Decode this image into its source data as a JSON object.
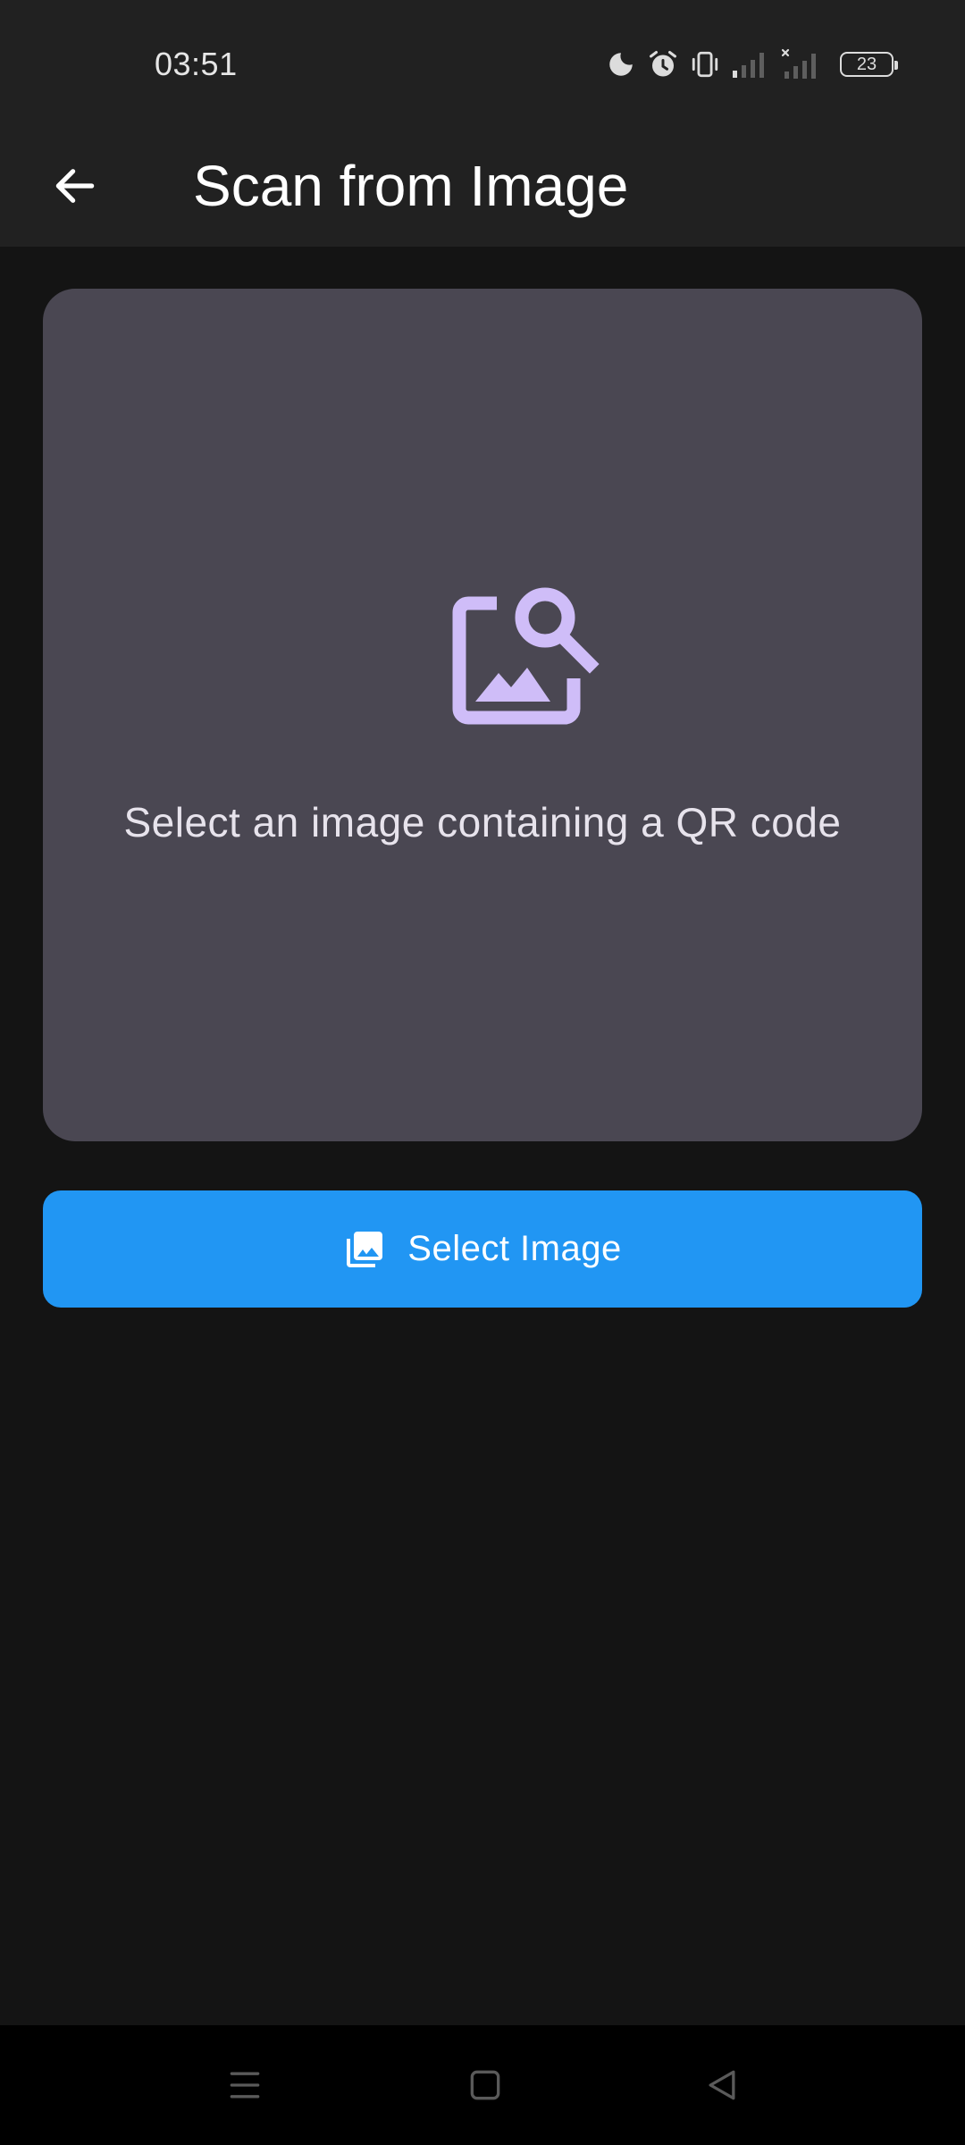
{
  "status_bar": {
    "time": "03:51",
    "battery_level": "23",
    "icons": [
      "moon-icon",
      "alarm-icon",
      "vibrate-icon",
      "signal-icon",
      "signal-no-service-icon",
      "battery-icon"
    ]
  },
  "app_bar": {
    "title": "Scan from Image",
    "back_icon": "arrow-back-icon"
  },
  "placeholder": {
    "icon": "image-search-icon",
    "message": "Select an image containing a QR code"
  },
  "select_button": {
    "icon": "photo-library-icon",
    "label": "Select Image"
  },
  "nav_bar": {
    "icons": [
      "menu-icon",
      "home-icon",
      "back-triangle-icon"
    ]
  },
  "colors": {
    "status_bar_bg": "#212121",
    "app_bar_bg": "#212121",
    "page_bg": "#141414",
    "card_bg": "#4a4752",
    "icon_accent": "#cfbdf8",
    "button_bg": "#2196f3",
    "nav_bar_bg": "#000000"
  }
}
